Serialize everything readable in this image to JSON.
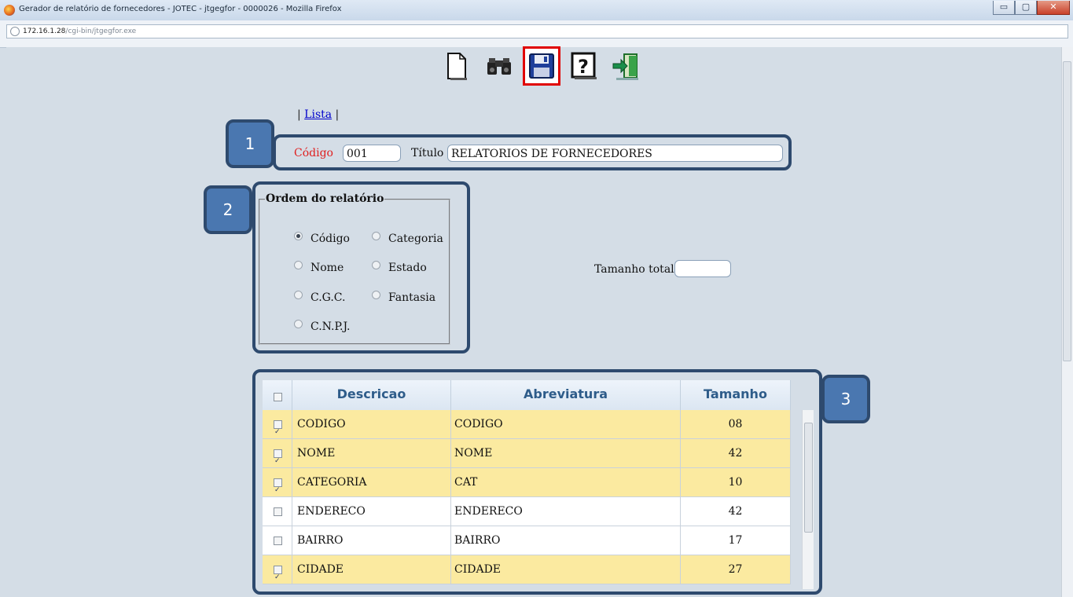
{
  "window": {
    "title": "Gerador de relatório de fornecedores - JOTEC - jtgegfor - 0000026 - Mozilla Firefox",
    "minimize": "▭",
    "maximize": "▢",
    "close": "✕"
  },
  "address": {
    "host": "172.16.1.28",
    "path": "/cgi-bin/jtgegfor.exe"
  },
  "toolbar": {
    "icons": [
      "new-document-icon",
      "binoculars-search-icon",
      "save-floppy-icon",
      "help-question-icon",
      "exit-door-icon"
    ],
    "selected": "save-floppy-icon"
  },
  "nav": {
    "pre": "| ",
    "lista": "Lista",
    "post": " |"
  },
  "callouts": [
    "1",
    "2",
    "3"
  ],
  "header": {
    "codigo_label": "Código",
    "codigo_value": "001",
    "titulo_label": "Título",
    "titulo_value": "RELATORIOS DE FORNECEDORES"
  },
  "ordem": {
    "legend": "Ordem do relatório",
    "options": [
      {
        "label": "Código",
        "checked": true
      },
      {
        "label": "Categoria",
        "checked": false
      },
      {
        "label": "Nome",
        "checked": false
      },
      {
        "label": "Estado",
        "checked": false
      },
      {
        "label": "C.G.C.",
        "checked": false
      },
      {
        "label": "Fantasia",
        "checked": false
      },
      {
        "label": "C.N.P.J.",
        "checked": false
      }
    ]
  },
  "tamanho_total": {
    "label": "Tamanho total",
    "value": ""
  },
  "table": {
    "headers": [
      "Descricao",
      "Abreviatura",
      "Tamanho"
    ],
    "header_checkbox": false,
    "rows": [
      {
        "checked": true,
        "descricao": "CODIGO",
        "abreviatura": "CODIGO",
        "tamanho": "08"
      },
      {
        "checked": true,
        "descricao": "NOME",
        "abreviatura": "NOME",
        "tamanho": "42"
      },
      {
        "checked": true,
        "descricao": "CATEGORIA",
        "abreviatura": "CAT",
        "tamanho": "10"
      },
      {
        "checked": false,
        "descricao": "ENDERECO",
        "abreviatura": "ENDERECO",
        "tamanho": "42"
      },
      {
        "checked": false,
        "descricao": "BAIRRO",
        "abreviatura": "BAIRRO",
        "tamanho": "17"
      },
      {
        "checked": true,
        "descricao": "CIDADE",
        "abreviatura": "CIDADE",
        "tamanho": "27"
      }
    ]
  },
  "colors": {
    "callout_fill": "#4a77b0",
    "callout_border": "#2e4a6e",
    "checked_row": "#fbeaa0",
    "header_text": "#2e5c8a",
    "required_label": "#e02020",
    "selected_tool_outline": "#e00000"
  }
}
